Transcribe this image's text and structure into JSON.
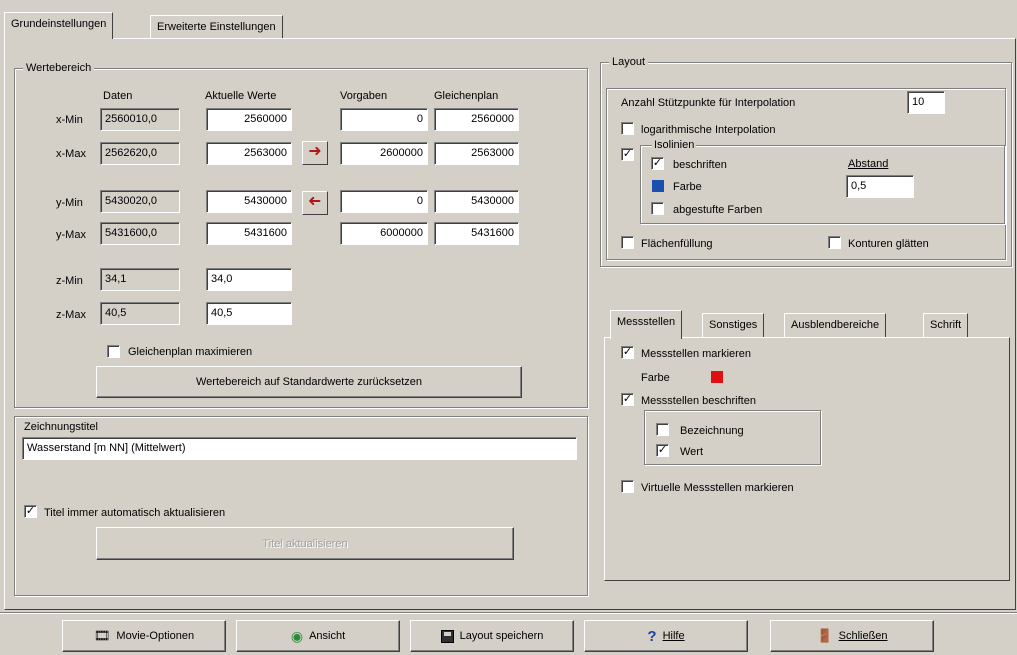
{
  "tabs": {
    "main": [
      "Grundeinstellungen",
      "Erweiterte Einstellungen"
    ],
    "sub": [
      "Messstellen",
      "Sonstiges",
      "Ausblendbereiche",
      "Schrift"
    ]
  },
  "wertebereich": {
    "title": "Wertebereich",
    "headers": {
      "daten": "Daten",
      "aktuell": "Aktuelle Werte",
      "vorgaben": "Vorgaben",
      "gleich": "Gleichenplan"
    },
    "rows": [
      {
        "label": "x-Min",
        "daten": "2560010,0",
        "aktuell": "2560000",
        "vorgabe": "0",
        "gleich": "2560000"
      },
      {
        "label": "x-Max",
        "daten": "2562620,0",
        "aktuell": "2563000",
        "vorgabe": "2600000",
        "gleich": "2563000"
      },
      {
        "label": "y-Min",
        "daten": "5430020,0",
        "aktuell": "5430000",
        "vorgabe": "0",
        "gleich": "5430000"
      },
      {
        "label": "y-Max",
        "daten": "5431600,0",
        "aktuell": "5431600",
        "vorgabe": "6000000",
        "gleich": "5431600"
      },
      {
        "label": "z-Min",
        "daten": "34,1",
        "aktuell": "34,0"
      },
      {
        "label": "z-Max",
        "daten": "40,5",
        "aktuell": "40,5"
      }
    ],
    "maximize_label": "Gleichenplan maximieren",
    "reset_button": "Wertebereich auf Standardwerte zurücksetzen"
  },
  "zeichnung": {
    "title": "Zeichnungstitel",
    "value": "Wasserstand [m NN] (Mittelwert)",
    "auto_update_label": "Titel immer automatisch aktualisieren",
    "update_button": "Titel aktualisieren"
  },
  "layout": {
    "title": "Layout",
    "stuetz_label": "Anzahl Stützpunkte für Interpolation",
    "stuetz_value": "10",
    "log_label": "logarithmische Interpolation",
    "isolinien_label": "Isolinien",
    "beschriften_label": "beschriften",
    "abstand_label": "Abstand",
    "abstand_value": "0,5",
    "farbe_label": "Farbe",
    "farbe_color": "#1a4fb0",
    "abgestuft_label": "abgestufte Farben",
    "flaechen_label": "Flächenfüllung",
    "konturen_label": "Konturen glätten"
  },
  "messstellen": {
    "markieren_label": "Messstellen markieren",
    "farbe_label": "Farbe",
    "farbe_color": "#e01010",
    "beschriften_label": "Messstellen beschriften",
    "bezeichnung_label": "Bezeichnung",
    "wert_label": "Wert",
    "virtuelle_label": "Virtuelle Messstellen markieren"
  },
  "footer": {
    "movie": "Movie-Optionen",
    "ansicht": "Ansicht",
    "layout_speichern": "Layout speichern",
    "hilfe": "Hilfe",
    "schliessen": "Schließen"
  }
}
